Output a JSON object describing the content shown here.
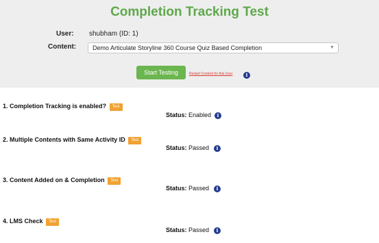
{
  "header": {
    "title": "Completion Tracking Test",
    "user_label": "User:",
    "user_value": "shubham (ID: 1)",
    "content_label": "Content:",
    "content_selected": "Demo Articulate Storyline 360 Course Quiz Based Completion",
    "start_button": "Start Testing",
    "restart_link": "Restart Content for this User"
  },
  "tests": [
    {
      "title": "1. Completion Tracking is enabled?",
      "badge": "Test",
      "status_label": "Status:",
      "status_value": "Enabled"
    },
    {
      "title": "2. Multiple Contents with Same Activity ID",
      "badge": "Test",
      "status_label": "Status:",
      "status_value": "Passed"
    },
    {
      "title": "3. Content Added on & Completion",
      "badge": "Test",
      "status_label": "Status:",
      "status_value": "Passed"
    },
    {
      "title": "4. LMS Check",
      "badge": "Test",
      "status_label": "Status:",
      "status_value": "Passed"
    }
  ],
  "icons": {
    "info": "info-icon",
    "dropdown": "chevron-down-icon"
  },
  "colors": {
    "title_green": "#5fa84b",
    "button_green": "#6bb64f",
    "badge_orange": "#f0a232",
    "info_blue": "#243c8f",
    "link_red": "#d9382f",
    "panel_bg": "#eeeeee"
  }
}
